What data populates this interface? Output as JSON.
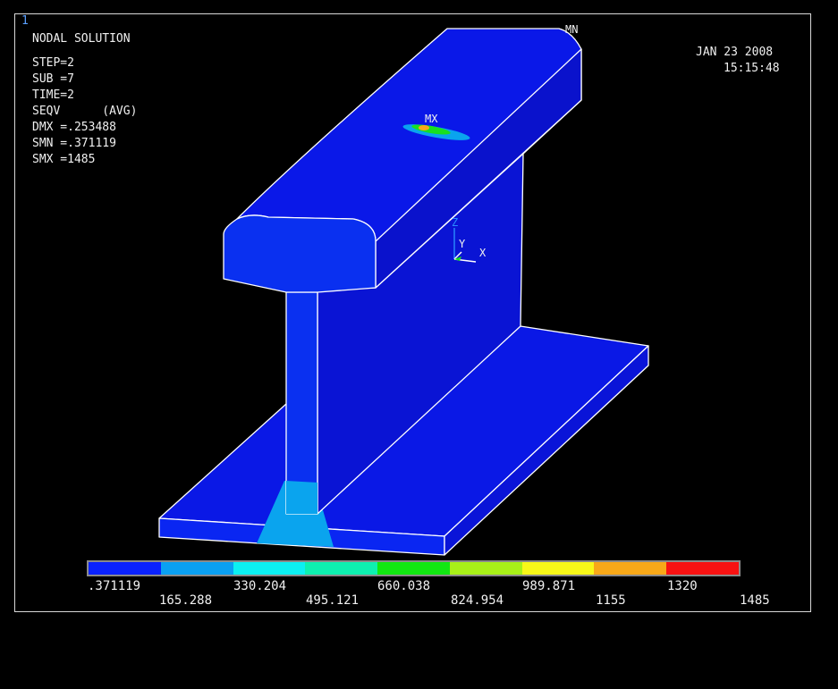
{
  "window_number": "1",
  "header": {
    "title": "NODAL SOLUTION",
    "step": "STEP=2",
    "sub": "SUB =7",
    "time": "TIME=2",
    "result": "SEQV      (AVG)",
    "dmx": "DMX =.253488",
    "smn": "SMN =.371119",
    "smx": "SMX =1485"
  },
  "timestamp": {
    "date": "JAN 23 2008",
    "time": "15:15:48"
  },
  "markers": {
    "mn": "MN",
    "mx": "MX"
  },
  "triad": {
    "z": "Z",
    "y": "Y",
    "x": "X"
  },
  "legend": {
    "colors": [
      "#0a22ff",
      "#0aa0f2",
      "#0cf0f2",
      "#0ef0b0",
      "#12e812",
      "#a8f018",
      "#f8f818",
      "#f8a818",
      "#f81212"
    ],
    "labels_top": [
      ".371119",
      "330.204",
      "660.038",
      "989.871",
      "1320"
    ],
    "labels_bottom": [
      "165.288",
      "495.121",
      "824.954",
      "1155",
      "1485"
    ]
  },
  "colors": {
    "body": "#0a18e8",
    "body_light": "#0a30f0",
    "edge": "#ffffff",
    "min_region": "#0aa4ee"
  }
}
